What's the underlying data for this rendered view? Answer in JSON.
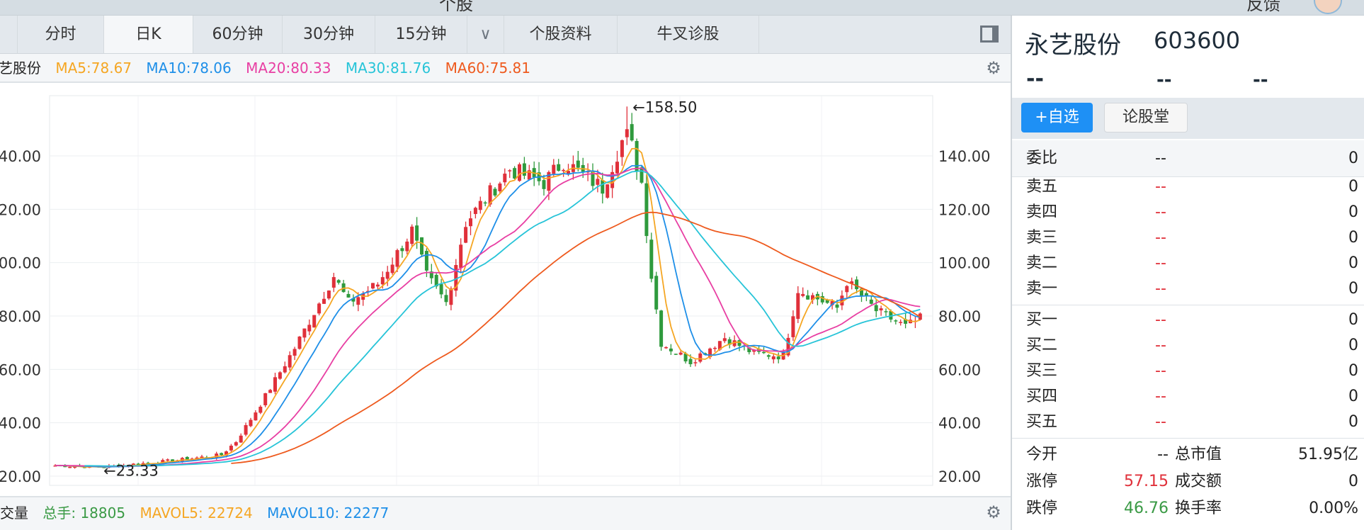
{
  "window": {
    "title": "个股",
    "user": "反馈"
  },
  "tabs": [
    "分时",
    "日K",
    "60分钟",
    "30分钟",
    "15分钟",
    "个股资料",
    "牛叉诊股"
  ],
  "active_tab": "日K",
  "ma_legend": {
    "name": "永艺股份",
    "ma5": "MA5:78.67",
    "ma10": "MA10:78.06",
    "ma20": "MA20:80.33",
    "ma30": "MA30:81.76",
    "ma60": "MA60:75.81"
  },
  "colors": {
    "ma5": "#f5a623",
    "ma10": "#1e8fe8",
    "ma20": "#e83fa3",
    "ma30": "#27c4d8",
    "ma60": "#ee5a1e",
    "up": "#e0303a",
    "down": "#2f9a3d",
    "accent": "#1e90f5"
  },
  "volume": {
    "label": "成交量",
    "total": "总手: 18805",
    "mavol5": "MAVOL5: 22724",
    "mavol10": "MAVOL10: 22277"
  },
  "stock": {
    "name": "永艺股份",
    "code": "603600",
    "price": "--",
    "change": "--",
    "pct": "--"
  },
  "buttons": {
    "watch": "+自选",
    "forum": "论股堂"
  },
  "weibi": {
    "label": "委比",
    "mid": "--",
    "value": "0"
  },
  "asks": [
    {
      "label": "卖五",
      "price": "--",
      "vol": "0"
    },
    {
      "label": "卖四",
      "price": "--",
      "vol": "0"
    },
    {
      "label": "卖三",
      "price": "--",
      "vol": "0"
    },
    {
      "label": "卖二",
      "price": "--",
      "vol": "0"
    },
    {
      "label": "卖一",
      "price": "--",
      "vol": "0"
    }
  ],
  "bids": [
    {
      "label": "买一",
      "price": "--",
      "vol": "0"
    },
    {
      "label": "买二",
      "price": "--",
      "vol": "0"
    },
    {
      "label": "买三",
      "price": "--",
      "vol": "0"
    },
    {
      "label": "买四",
      "price": "--",
      "vol": "0"
    },
    {
      "label": "买五",
      "price": "--",
      "vol": "0"
    }
  ],
  "stats": [
    {
      "l1": "今开",
      "v1": "--",
      "l2": "总市值",
      "v2": "51.95亿"
    },
    {
      "l1": "涨停",
      "v1": "57.15",
      "l2": "成交额",
      "v2": "0"
    },
    {
      "l1": "跌停",
      "v1": "46.76",
      "l2": "换手率",
      "v2": "0.00%"
    }
  ],
  "chart_data": {
    "type": "candlestick",
    "y_ticks": [
      "140.00",
      "120.00",
      "100.00",
      "80.00",
      "60.00",
      "40.00",
      "20.00"
    ],
    "y_tick_values": [
      140,
      120,
      100,
      80,
      60,
      40,
      20
    ],
    "ylim": [
      15,
      160
    ],
    "n_days": 178,
    "close_waypoints": [
      [
        0,
        24
      ],
      [
        9,
        23.3
      ],
      [
        25,
        26
      ],
      [
        34,
        28
      ],
      [
        37,
        33
      ],
      [
        42,
        47
      ],
      [
        49,
        68
      ],
      [
        57,
        95
      ],
      [
        60,
        85
      ],
      [
        66,
        92
      ],
      [
        73,
        112
      ],
      [
        76,
        95
      ],
      [
        80,
        85
      ],
      [
        84,
        115
      ],
      [
        93,
        135
      ],
      [
        100,
        130
      ],
      [
        104,
        138
      ],
      [
        112,
        128
      ],
      [
        117,
        150
      ],
      [
        120,
        130
      ],
      [
        122,
        95
      ],
      [
        124,
        70
      ],
      [
        130,
        63
      ],
      [
        137,
        72
      ],
      [
        143,
        66
      ],
      [
        149,
        65
      ],
      [
        152,
        90
      ],
      [
        160,
        83
      ],
      [
        162,
        93
      ],
      [
        168,
        82
      ],
      [
        174,
        76
      ],
      [
        177,
        79
      ]
    ],
    "high_marker": {
      "index": 117,
      "value": 158.5,
      "label": "←158.50"
    },
    "low_marker": {
      "index": 9,
      "value": 23.33,
      "label": "←23.33"
    },
    "ma_periods": [
      5,
      10,
      20,
      30,
      60
    ]
  }
}
